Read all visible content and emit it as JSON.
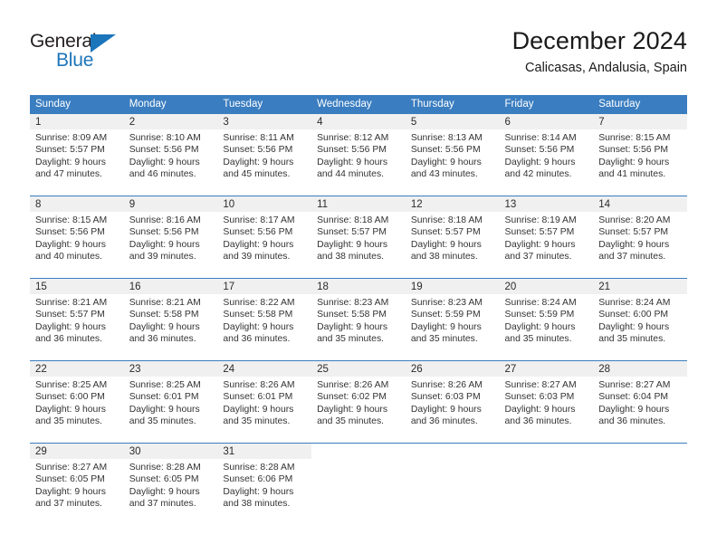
{
  "logo": {
    "word_top": "General",
    "word_bottom": "Blue",
    "triangle_color": "#1b75bb",
    "top_color": "#231f20"
  },
  "header": {
    "month_title": "December 2024",
    "location": "Calicasas, Andalusia, Spain"
  },
  "theme": {
    "header_row_bg": "#3a7dc0",
    "header_row_text": "#ffffff",
    "daynum_band_bg": "#f0f0f0",
    "body_text": "#333333",
    "week_divider": "#3a7dc0"
  },
  "weekdays": [
    "Sunday",
    "Monday",
    "Tuesday",
    "Wednesday",
    "Thursday",
    "Friday",
    "Saturday"
  ],
  "weeks": [
    [
      {
        "day": "1",
        "sunrise": "Sunrise: 8:09 AM",
        "sunset": "Sunset: 5:57 PM",
        "daylight_line1": "Daylight: 9 hours",
        "daylight_line2": "and 47 minutes."
      },
      {
        "day": "2",
        "sunrise": "Sunrise: 8:10 AM",
        "sunset": "Sunset: 5:56 PM",
        "daylight_line1": "Daylight: 9 hours",
        "daylight_line2": "and 46 minutes."
      },
      {
        "day": "3",
        "sunrise": "Sunrise: 8:11 AM",
        "sunset": "Sunset: 5:56 PM",
        "daylight_line1": "Daylight: 9 hours",
        "daylight_line2": "and 45 minutes."
      },
      {
        "day": "4",
        "sunrise": "Sunrise: 8:12 AM",
        "sunset": "Sunset: 5:56 PM",
        "daylight_line1": "Daylight: 9 hours",
        "daylight_line2": "and 44 minutes."
      },
      {
        "day": "5",
        "sunrise": "Sunrise: 8:13 AM",
        "sunset": "Sunset: 5:56 PM",
        "daylight_line1": "Daylight: 9 hours",
        "daylight_line2": "and 43 minutes."
      },
      {
        "day": "6",
        "sunrise": "Sunrise: 8:14 AM",
        "sunset": "Sunset: 5:56 PM",
        "daylight_line1": "Daylight: 9 hours",
        "daylight_line2": "and 42 minutes."
      },
      {
        "day": "7",
        "sunrise": "Sunrise: 8:15 AM",
        "sunset": "Sunset: 5:56 PM",
        "daylight_line1": "Daylight: 9 hours",
        "daylight_line2": "and 41 minutes."
      }
    ],
    [
      {
        "day": "8",
        "sunrise": "Sunrise: 8:15 AM",
        "sunset": "Sunset: 5:56 PM",
        "daylight_line1": "Daylight: 9 hours",
        "daylight_line2": "and 40 minutes."
      },
      {
        "day": "9",
        "sunrise": "Sunrise: 8:16 AM",
        "sunset": "Sunset: 5:56 PM",
        "daylight_line1": "Daylight: 9 hours",
        "daylight_line2": "and 39 minutes."
      },
      {
        "day": "10",
        "sunrise": "Sunrise: 8:17 AM",
        "sunset": "Sunset: 5:56 PM",
        "daylight_line1": "Daylight: 9 hours",
        "daylight_line2": "and 39 minutes."
      },
      {
        "day": "11",
        "sunrise": "Sunrise: 8:18 AM",
        "sunset": "Sunset: 5:57 PM",
        "daylight_line1": "Daylight: 9 hours",
        "daylight_line2": "and 38 minutes."
      },
      {
        "day": "12",
        "sunrise": "Sunrise: 8:18 AM",
        "sunset": "Sunset: 5:57 PM",
        "daylight_line1": "Daylight: 9 hours",
        "daylight_line2": "and 38 minutes."
      },
      {
        "day": "13",
        "sunrise": "Sunrise: 8:19 AM",
        "sunset": "Sunset: 5:57 PM",
        "daylight_line1": "Daylight: 9 hours",
        "daylight_line2": "and 37 minutes."
      },
      {
        "day": "14",
        "sunrise": "Sunrise: 8:20 AM",
        "sunset": "Sunset: 5:57 PM",
        "daylight_line1": "Daylight: 9 hours",
        "daylight_line2": "and 37 minutes."
      }
    ],
    [
      {
        "day": "15",
        "sunrise": "Sunrise: 8:21 AM",
        "sunset": "Sunset: 5:57 PM",
        "daylight_line1": "Daylight: 9 hours",
        "daylight_line2": "and 36 minutes."
      },
      {
        "day": "16",
        "sunrise": "Sunrise: 8:21 AM",
        "sunset": "Sunset: 5:58 PM",
        "daylight_line1": "Daylight: 9 hours",
        "daylight_line2": "and 36 minutes."
      },
      {
        "day": "17",
        "sunrise": "Sunrise: 8:22 AM",
        "sunset": "Sunset: 5:58 PM",
        "daylight_line1": "Daylight: 9 hours",
        "daylight_line2": "and 36 minutes."
      },
      {
        "day": "18",
        "sunrise": "Sunrise: 8:23 AM",
        "sunset": "Sunset: 5:58 PM",
        "daylight_line1": "Daylight: 9 hours",
        "daylight_line2": "and 35 minutes."
      },
      {
        "day": "19",
        "sunrise": "Sunrise: 8:23 AM",
        "sunset": "Sunset: 5:59 PM",
        "daylight_line1": "Daylight: 9 hours",
        "daylight_line2": "and 35 minutes."
      },
      {
        "day": "20",
        "sunrise": "Sunrise: 8:24 AM",
        "sunset": "Sunset: 5:59 PM",
        "daylight_line1": "Daylight: 9 hours",
        "daylight_line2": "and 35 minutes."
      },
      {
        "day": "21",
        "sunrise": "Sunrise: 8:24 AM",
        "sunset": "Sunset: 6:00 PM",
        "daylight_line1": "Daylight: 9 hours",
        "daylight_line2": "and 35 minutes."
      }
    ],
    [
      {
        "day": "22",
        "sunrise": "Sunrise: 8:25 AM",
        "sunset": "Sunset: 6:00 PM",
        "daylight_line1": "Daylight: 9 hours",
        "daylight_line2": "and 35 minutes."
      },
      {
        "day": "23",
        "sunrise": "Sunrise: 8:25 AM",
        "sunset": "Sunset: 6:01 PM",
        "daylight_line1": "Daylight: 9 hours",
        "daylight_line2": "and 35 minutes."
      },
      {
        "day": "24",
        "sunrise": "Sunrise: 8:26 AM",
        "sunset": "Sunset: 6:01 PM",
        "daylight_line1": "Daylight: 9 hours",
        "daylight_line2": "and 35 minutes."
      },
      {
        "day": "25",
        "sunrise": "Sunrise: 8:26 AM",
        "sunset": "Sunset: 6:02 PM",
        "daylight_line1": "Daylight: 9 hours",
        "daylight_line2": "and 35 minutes."
      },
      {
        "day": "26",
        "sunrise": "Sunrise: 8:26 AM",
        "sunset": "Sunset: 6:03 PM",
        "daylight_line1": "Daylight: 9 hours",
        "daylight_line2": "and 36 minutes."
      },
      {
        "day": "27",
        "sunrise": "Sunrise: 8:27 AM",
        "sunset": "Sunset: 6:03 PM",
        "daylight_line1": "Daylight: 9 hours",
        "daylight_line2": "and 36 minutes."
      },
      {
        "day": "28",
        "sunrise": "Sunrise: 8:27 AM",
        "sunset": "Sunset: 6:04 PM",
        "daylight_line1": "Daylight: 9 hours",
        "daylight_line2": "and 36 minutes."
      }
    ],
    [
      {
        "day": "29",
        "sunrise": "Sunrise: 8:27 AM",
        "sunset": "Sunset: 6:05 PM",
        "daylight_line1": "Daylight: 9 hours",
        "daylight_line2": "and 37 minutes."
      },
      {
        "day": "30",
        "sunrise": "Sunrise: 8:28 AM",
        "sunset": "Sunset: 6:05 PM",
        "daylight_line1": "Daylight: 9 hours",
        "daylight_line2": "and 37 minutes."
      },
      {
        "day": "31",
        "sunrise": "Sunrise: 8:28 AM",
        "sunset": "Sunset: 6:06 PM",
        "daylight_line1": "Daylight: 9 hours",
        "daylight_line2": "and 38 minutes."
      },
      {
        "day": "",
        "sunrise": "",
        "sunset": "",
        "daylight_line1": "",
        "daylight_line2": ""
      },
      {
        "day": "",
        "sunrise": "",
        "sunset": "",
        "daylight_line1": "",
        "daylight_line2": ""
      },
      {
        "day": "",
        "sunrise": "",
        "sunset": "",
        "daylight_line1": "",
        "daylight_line2": ""
      },
      {
        "day": "",
        "sunrise": "",
        "sunset": "",
        "daylight_line1": "",
        "daylight_line2": ""
      }
    ]
  ]
}
